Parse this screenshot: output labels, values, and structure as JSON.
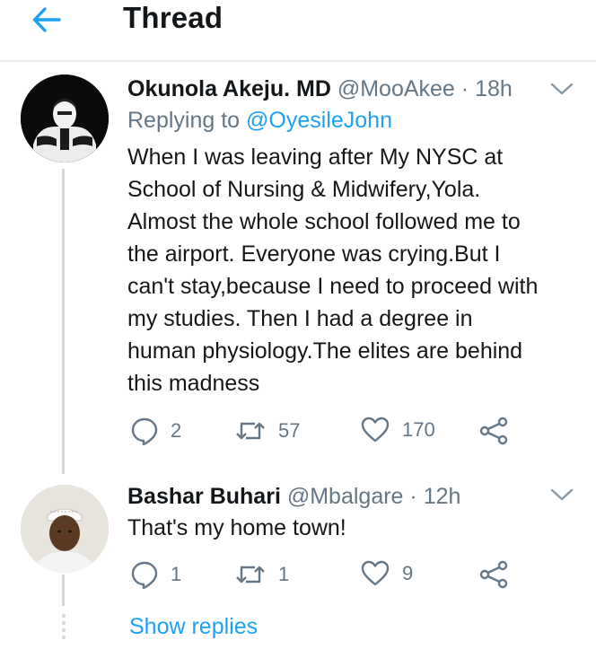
{
  "header": {
    "title": "Thread",
    "back_icon": "arrow-left-icon",
    "accent_color": "#1da1f2"
  },
  "tweets": [
    {
      "display_name": "Okunola Akeju. MD",
      "handle": "@MooAkee",
      "separator": "·",
      "time": "18h",
      "replying_prefix": "Replying to",
      "replying_to": "@OyesileJohn",
      "text_lines": [
        "When I was leaving after My NYSC at",
        "School of Nursing & Midwifery,Yola.",
        "Almost the whole school followed me to",
        "the airport. Everyone was crying.But I",
        "can't stay,because I need to proceed with",
        "my studies. Then I had a degree in",
        "human physiology.The elites are behind",
        "this madness"
      ],
      "replies": "2",
      "retweets": "57",
      "likes": "170"
    },
    {
      "display_name": "Bashar Buhari",
      "handle": "@Mbalgare",
      "separator": "·",
      "time": "12h",
      "text": "That's my home town!",
      "replies": "1",
      "retweets": "1",
      "likes": "9"
    }
  ],
  "show_replies": "Show replies",
  "icons": [
    "reply-icon",
    "retweet-icon",
    "like-icon",
    "share-icon",
    "chevron-down-icon"
  ],
  "colors": {
    "text": "#14171a",
    "secondary": "#657786",
    "link": "#1da1f2",
    "divider": "#e6ecf0"
  }
}
